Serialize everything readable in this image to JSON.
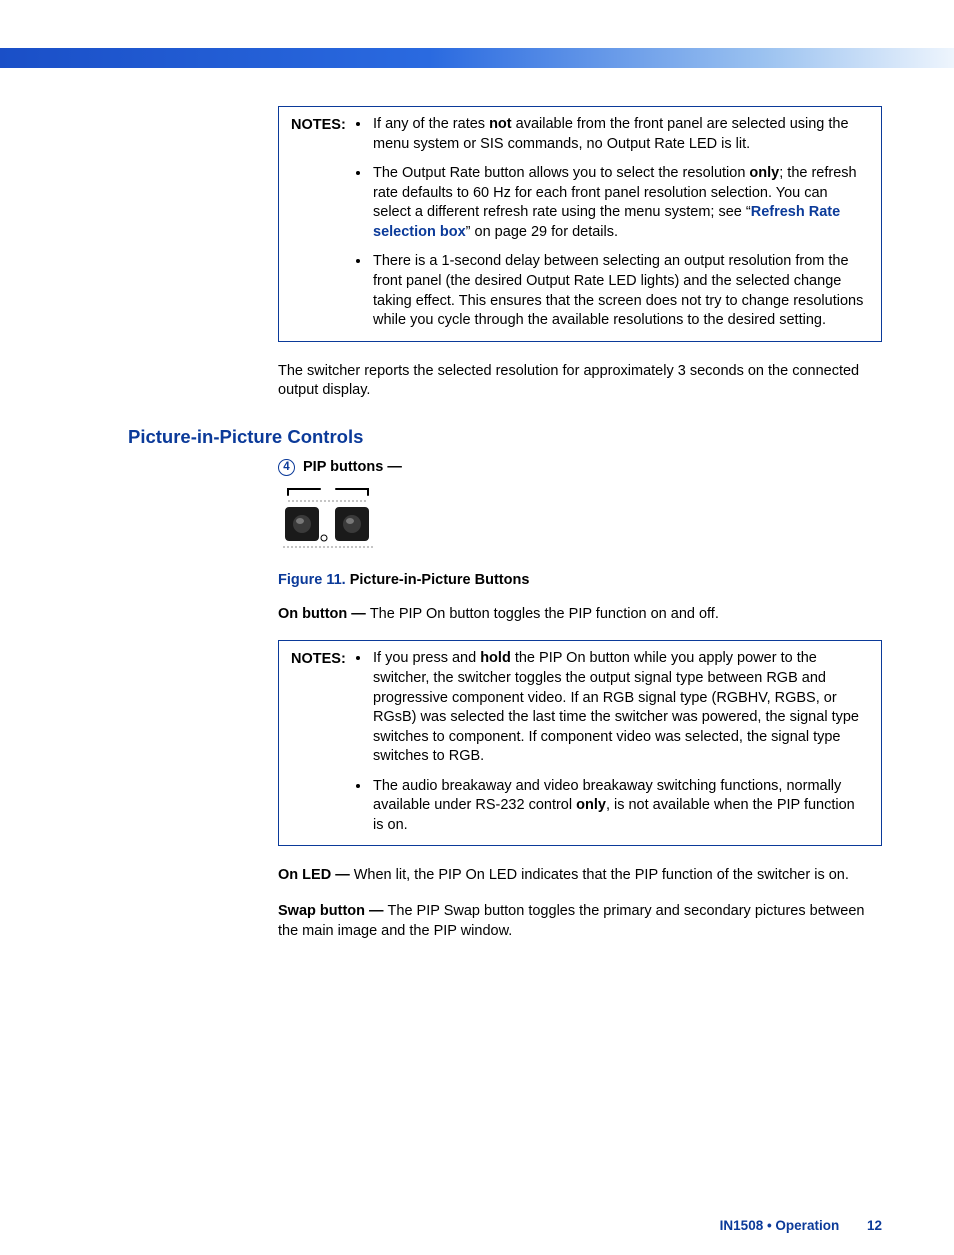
{
  "notes1": {
    "label": "NOTES:",
    "items": [
      {
        "pre": "If any of the rates ",
        "bold1": "not",
        "post1": " available from the front panel are selected using the menu system or SIS commands, no Output Rate LED is lit."
      },
      {
        "pre": "The Output Rate button allows you to select the resolution ",
        "bold1": "only",
        "post1": "; the refresh rate defaults to 60 Hz for each front panel resolution selection. You can select a different refresh rate using the menu system; see “",
        "link": "Refresh Rate selection box",
        "post2": "” on page 29 for details."
      },
      {
        "plain": "There is a 1-second delay between selecting an output resolution from the front panel (the desired Output Rate LED lights) and the selected change taking effect. This ensures that the screen does not try to change resolutions while you cycle through the available resolutions to the desired setting."
      }
    ]
  },
  "after_notes1": "The switcher reports the selected resolution for approximately 3 seconds on the connected output display.",
  "heading": "Picture-in-Picture Controls",
  "callout_num": "4",
  "pip_label": "PIP buttons —",
  "figure": {
    "num": "Figure 11.",
    "title": " Picture-in-Picture Buttons"
  },
  "on_button": {
    "lead": "On button — ",
    "text": "The PIP On button toggles the PIP function on and off."
  },
  "notes2": {
    "label": "NOTES:",
    "items": [
      {
        "pre": "If you press and ",
        "bold1": "hold",
        "post1": " the PIP On button while you apply power to the switcher, the switcher toggles the output signal type between RGB and progressive component video. If an RGB signal type (RGBHV, RGBS, or RGsB) was selected the last time the switcher was powered, the signal type switches to component. If component video was selected, the signal type switches to RGB."
      },
      {
        "pre": "The audio breakaway and video breakaway switching functions, normally available under RS-232 control ",
        "bold1": "only",
        "post1": ", is not available when the PIP function is on."
      }
    ]
  },
  "on_led": {
    "lead": "On LED — ",
    "text": "When lit, the PIP On LED indicates that the PIP function of the switcher is on."
  },
  "swap_button": {
    "lead": "Swap button — ",
    "text": "The PIP Swap button toggles the primary and secondary pictures between the main image and the PIP window."
  },
  "footer": {
    "doc": "IN1508 • Operation",
    "page": "12"
  }
}
